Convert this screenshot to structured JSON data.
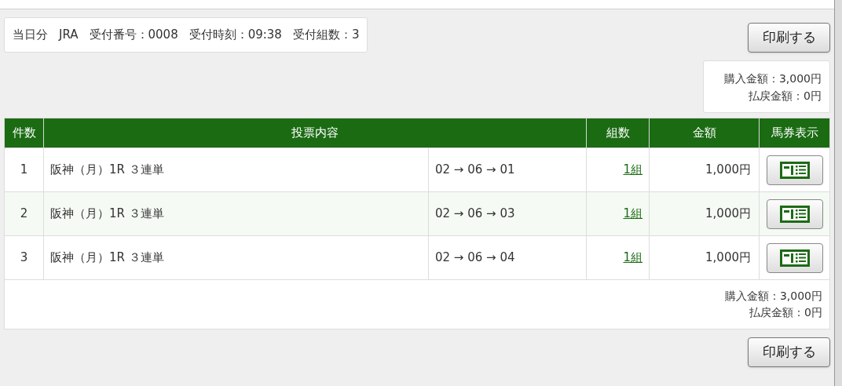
{
  "receipt_info": [
    "当日分",
    "JRA",
    "受付番号：0008",
    "受付時刻：09:38",
    "受付組数：3"
  ],
  "print_button_top": "印刷する",
  "summary_top": {
    "purchase": "購入金額：3,000円",
    "refund": "払戻金額：0円"
  },
  "table": {
    "columns": [
      "件数",
      "投票内容",
      "組数",
      "金額",
      "馬券表示"
    ],
    "rows": [
      {
        "number": "1",
        "race": "阪神（月）1R ３連単",
        "combination": "02 → 06 → 01",
        "sets": "1組",
        "amount": "1,000円"
      },
      {
        "number": "2",
        "race": "阪神（月）1R ３連単",
        "combination": "02 → 06 → 03",
        "sets": "1組",
        "amount": "1,000円"
      },
      {
        "number": "3",
        "race": "阪神（月）1R ３連単",
        "combination": "02 → 06 → 04",
        "sets": "1組",
        "amount": "1,000円"
      }
    ],
    "footer": {
      "purchase": "購入金額：3,000円",
      "refund": "払戻金額：0円"
    }
  },
  "print_button_bottom": "印刷する"
}
